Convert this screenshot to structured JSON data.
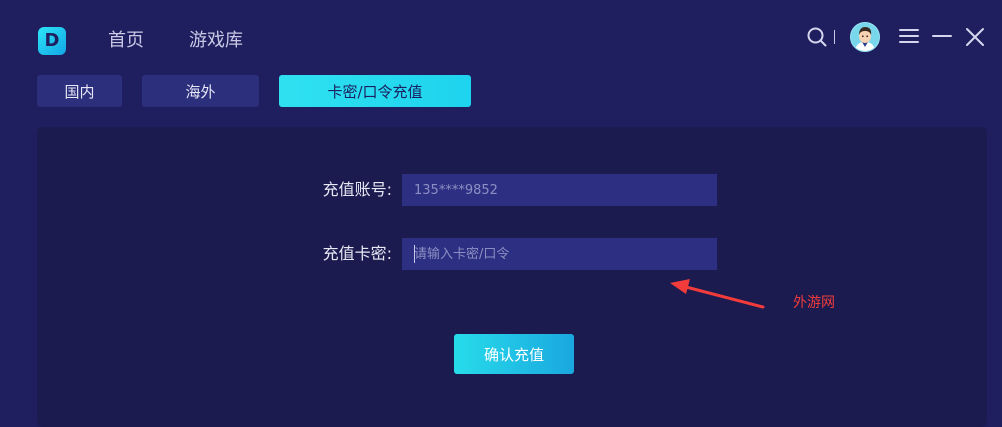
{
  "app": {
    "logo": "D"
  },
  "header": {
    "nav": [
      "首页",
      "游戏库"
    ]
  },
  "tabs": [
    {
      "label": "国内"
    },
    {
      "label": "海外"
    },
    {
      "label": "卡密/口令充值"
    }
  ],
  "form": {
    "account_label": "充值账号:",
    "account_value": "135****9852",
    "card_label": "充值卡密:",
    "card_placeholder": "请输入卡密/口令",
    "confirm_label": "确认充值"
  },
  "watermark": {
    "text": "外游网",
    "color": "#f23b3b"
  },
  "colors": {
    "background": "#1f1f5f",
    "panel": "#1b1b4f",
    "accent": "#2fe1f0",
    "input_bg": "#2d2f82"
  },
  "icons": [
    "logo-icon",
    "search-icon",
    "avatar",
    "menu-icon",
    "minimize-icon",
    "close-icon"
  ]
}
